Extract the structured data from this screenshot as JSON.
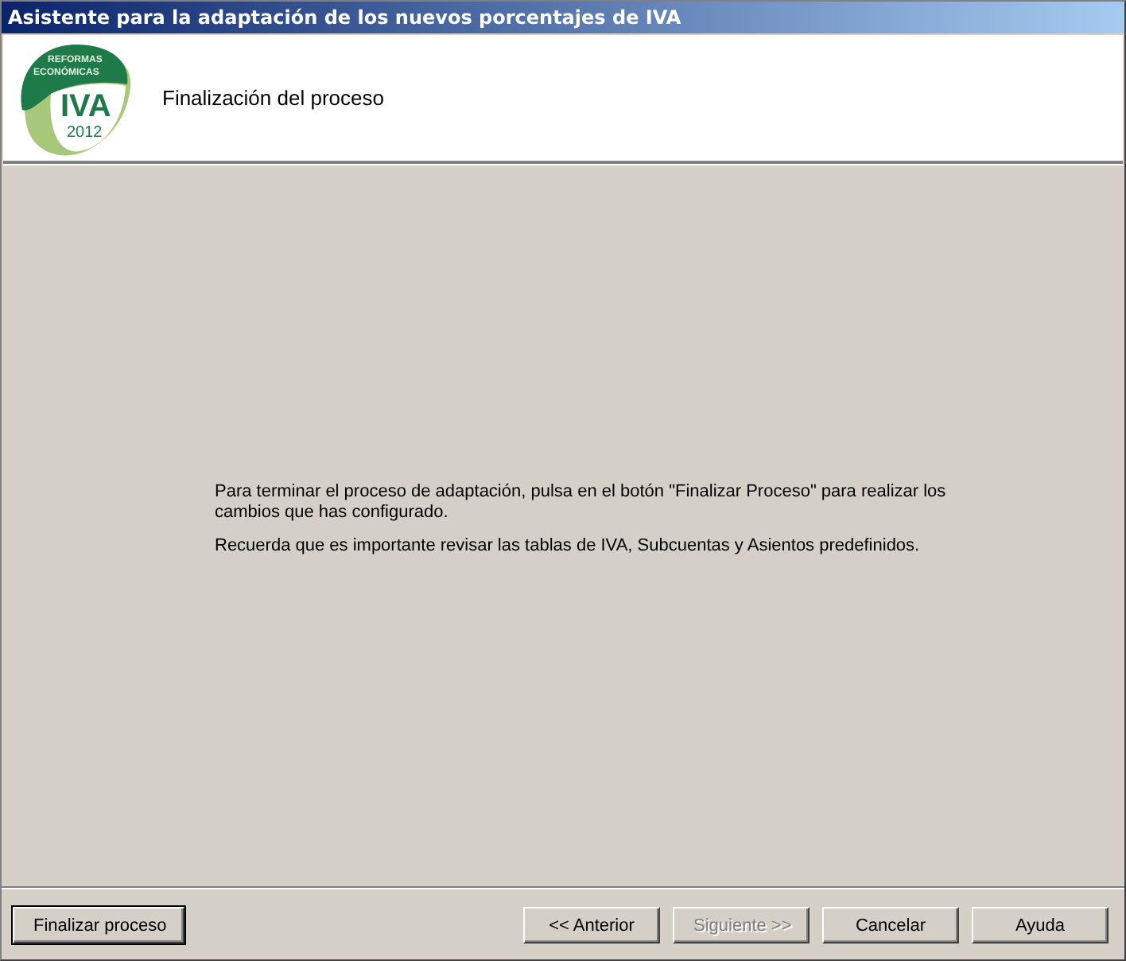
{
  "window": {
    "title": "Asistente para la adaptación de los nuevos porcentajes de IVA"
  },
  "header": {
    "logo": {
      "line_1": "REFORMAS",
      "line_2": "ECONÓMICAS",
      "big": "IVA",
      "year": "2012"
    },
    "title": "Finalización del proceso"
  },
  "body": {
    "paragraphs": [
      "Para terminar el proceso de adaptación, pulsa en el botón \"Finalizar Proceso\" para realizar los cambios que has configurado.",
      "Recuerda que es importante revisar las tablas de IVA, Subcuentas y Asientos predefinidos."
    ]
  },
  "left_buttons": [
    {
      "label": "Finalizar proceso",
      "disabled": false,
      "default": true
    }
  ],
  "right_buttons": [
    {
      "label": "<< Anterior",
      "disabled": false,
      "default": false
    },
    {
      "label": "Siguiente >>",
      "disabled": true,
      "default": false
    },
    {
      "label": "Cancelar",
      "disabled": false,
      "default": false
    },
    {
      "label": "Ayuda",
      "disabled": false,
      "default": false
    }
  ]
}
